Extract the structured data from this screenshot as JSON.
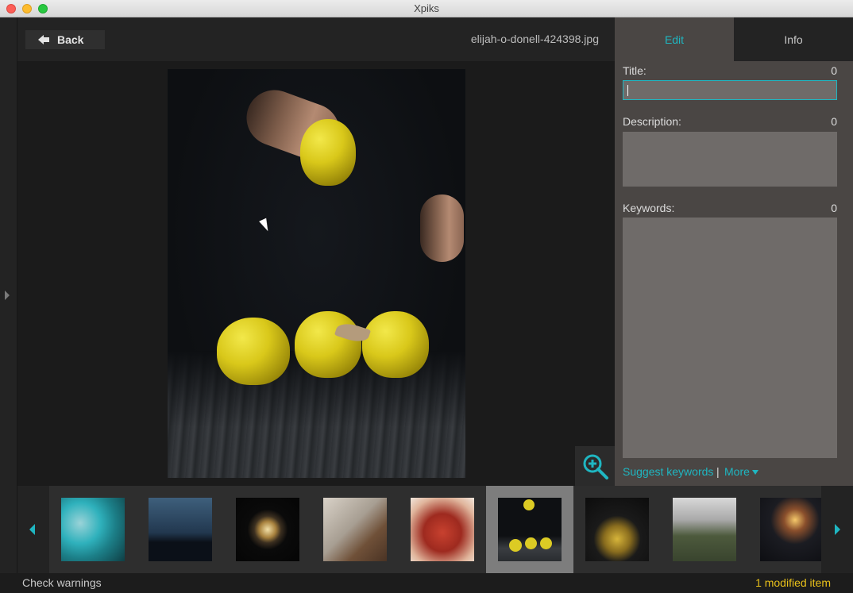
{
  "window": {
    "title": "Xpiks"
  },
  "header": {
    "back_label": "Back",
    "filename": "elijah-o-donell-424398.jpg"
  },
  "tabs": [
    {
      "label": "Edit",
      "active": true
    },
    {
      "label": "Info",
      "active": false
    }
  ],
  "fields": {
    "title": {
      "label": "Title:",
      "count": "0",
      "value": ""
    },
    "description": {
      "label": "Description:",
      "count": "0"
    },
    "keywords": {
      "label": "Keywords:",
      "count": "0"
    }
  },
  "actions": {
    "suggest_label": "Suggest keywords",
    "separator": "|",
    "more_label": "More"
  },
  "filmstrip": {
    "selected_index": 5,
    "count": 9
  },
  "status": {
    "check_warnings": "Check warnings",
    "modified": "1 modified item"
  },
  "colors": {
    "accent": "#1fb6c1",
    "warning": "#e8c01a"
  }
}
